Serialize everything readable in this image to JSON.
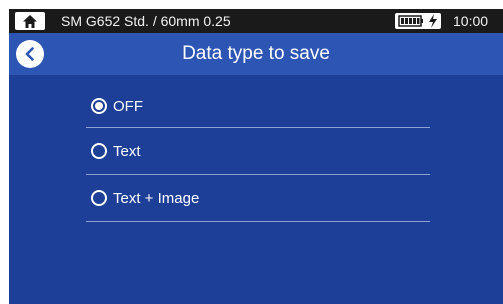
{
  "status_bar": {
    "title": "SM G652 Std. / 60mm 0.25",
    "time": "10:00",
    "home_icon": "home-icon",
    "battery_icon": "battery-icon",
    "charging_icon": "charging-icon"
  },
  "header": {
    "title": "Data type to save",
    "back_icon": "chevron-left-icon"
  },
  "options": [
    {
      "label": "OFF",
      "selected": true
    },
    {
      "label": "Text",
      "selected": false
    },
    {
      "label": "Text + Image",
      "selected": false
    }
  ],
  "colors": {
    "background": "#1e3f97",
    "header": "#2d56b4",
    "status_bar": "#1a1a1a",
    "divider": "#8ea2d6"
  }
}
